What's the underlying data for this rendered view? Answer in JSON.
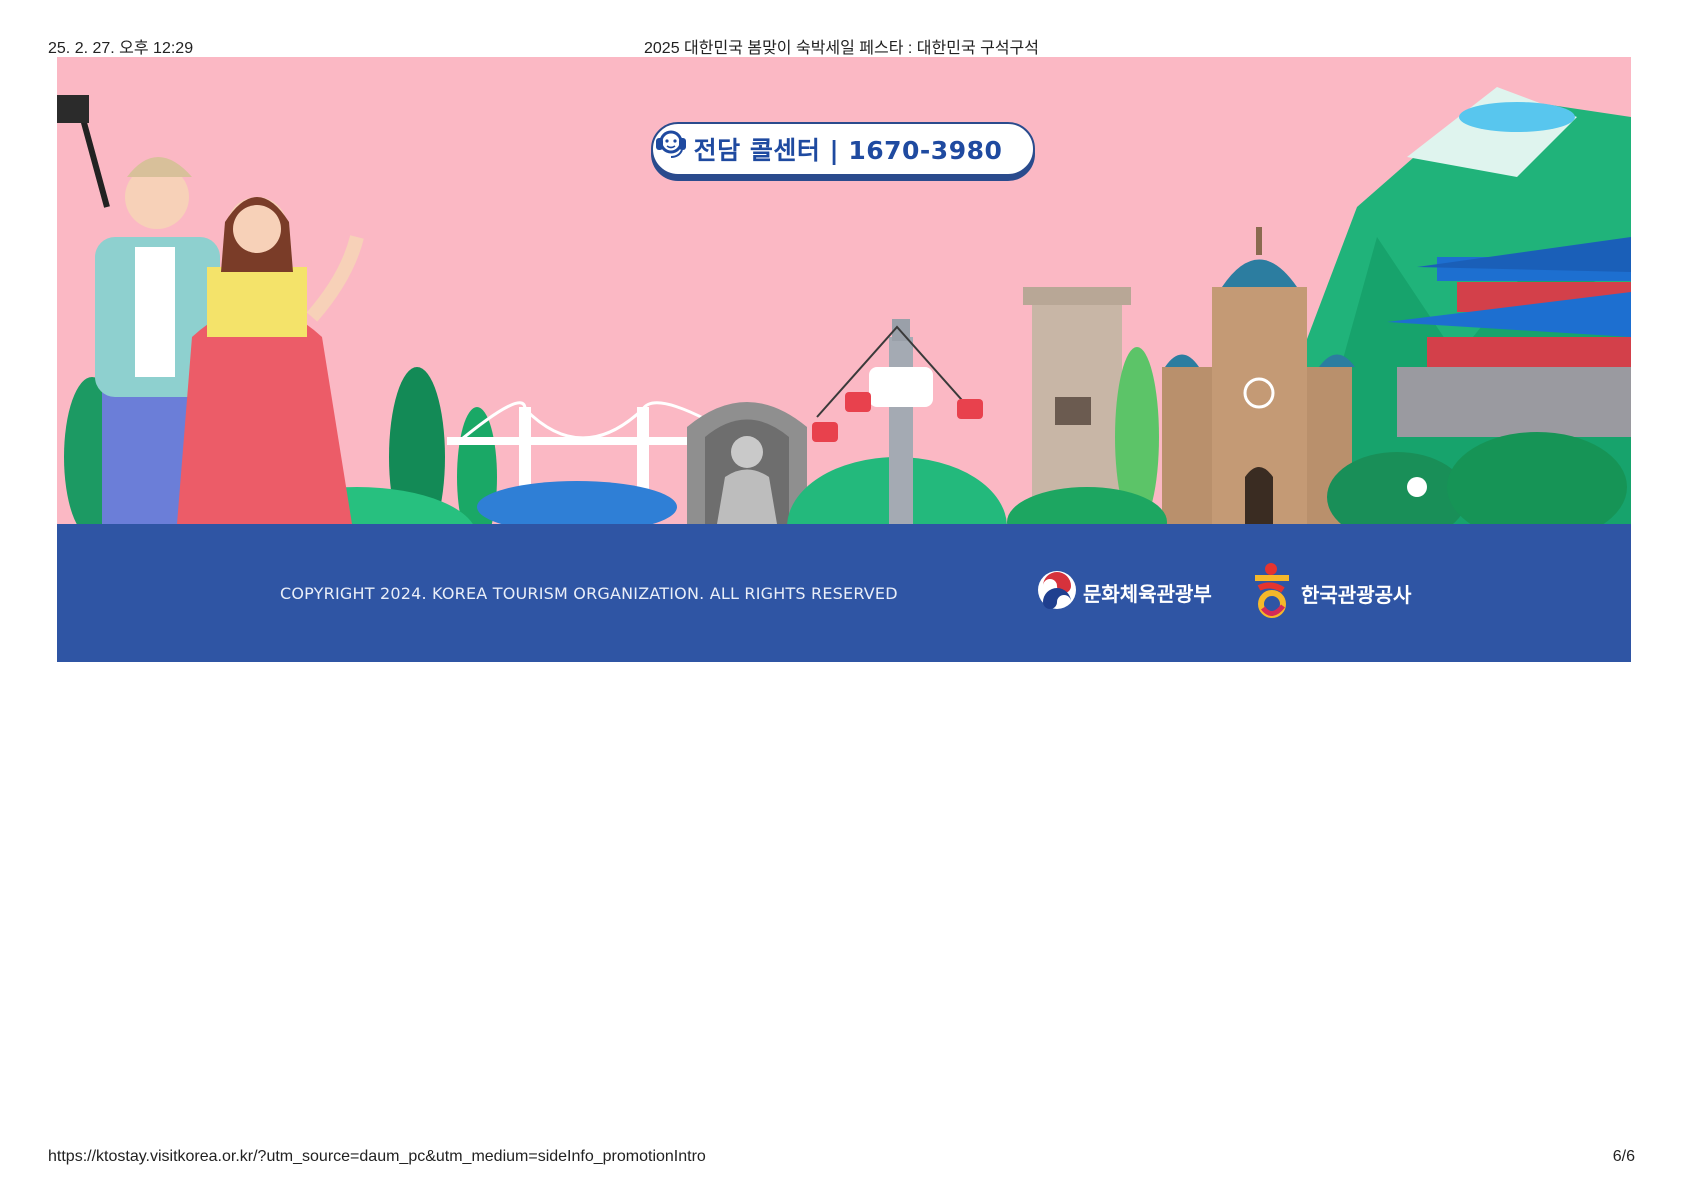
{
  "print_header": {
    "datetime": "25. 2. 27. 오후 12:29",
    "title": "2025 대한민국 봄맞이 숙박세일 페스타 : 대한민국 구석구석"
  },
  "banner": {
    "callcenter": "전담 콜센터 | 1670-3980",
    "copyright": "COPYRIGHT 2024. KOREA TOURISM ORGANIZATION. ALL RIGHTS RESERVED",
    "logos": {
      "mcst": "문화체육관광부",
      "kto": "한국관광공사"
    },
    "colors": {
      "sky": "#fbb8c4",
      "footer": "#2f55a4",
      "callcenter_text": "#1f4aa0"
    }
  },
  "print_footer": {
    "url": "https://ktostay.visitkorea.or.kr/?utm_source=daum_pc&utm_medium=sideInfo_promotionIntro",
    "page": "6/6"
  }
}
